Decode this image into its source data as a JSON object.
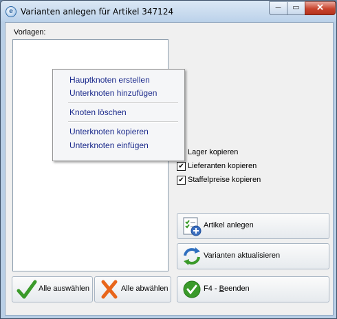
{
  "window": {
    "title": "Varianten anlegen für Artikel 347124",
    "app_icon_glyph": "e",
    "minimize_glyph": "─",
    "maximize_glyph": "▭",
    "close_glyph": "✕"
  },
  "vorlagen_label": "Vorlagen:",
  "context_menu": {
    "items": [
      "Hauptknoten erstellen",
      "Unterknoten hinzufügen",
      "Knoten löschen",
      "Unterknoten kopieren",
      "Unterknoten einfügen"
    ]
  },
  "options": {
    "lager_label": "Lager kopieren",
    "lieferanten_label": "Lieferanten kopieren",
    "lieferanten_checked": true,
    "staffelpreise_label": "Staffelpreise kopieren",
    "staffelpreise_checked": true,
    "check_glyph": "✔"
  },
  "buttons": {
    "artikel_anlegen": "Artikel anlegen",
    "varianten_aktualisieren": "Varianten aktualisieren",
    "alle_auswaehlen": "Alle auswählen",
    "alle_abwaehlen": "Alle abwählen",
    "beenden_prefix": "F4 - ",
    "beenden_underlined": "B",
    "beenden_rest": "eenden"
  },
  "colors": {
    "menu_text": "#1c2b8c",
    "close_button": "#c8442d",
    "check_green": "#3a9a2a",
    "cross_orange": "#e8651a"
  }
}
